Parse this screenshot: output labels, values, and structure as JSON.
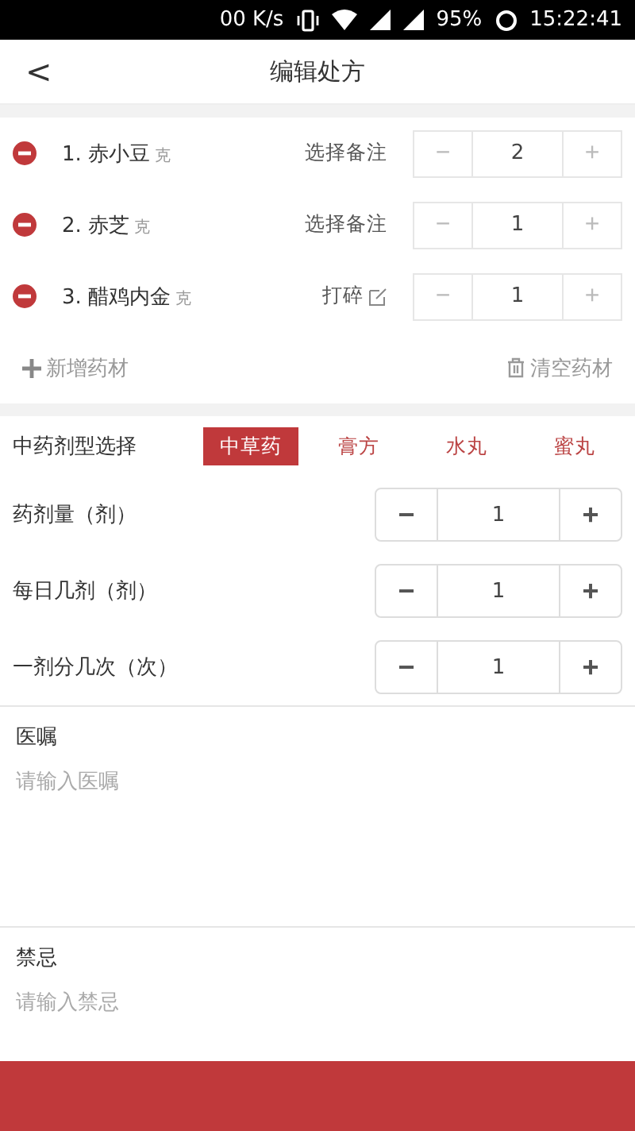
{
  "status_bar": {
    "speed": "00 K/s",
    "battery": "95%",
    "time": "15:22:41"
  },
  "header": {
    "back": "<",
    "title": "编辑处方"
  },
  "herbs": [
    {
      "index": "1.",
      "name": "赤小豆",
      "unit": "克",
      "note": "选择备注",
      "note_edit_icon": false,
      "minus": "−",
      "qty": "2",
      "plus": "+"
    },
    {
      "index": "2.",
      "name": "赤芝",
      "unit": "克",
      "note": "选择备注",
      "note_edit_icon": false,
      "minus": "−",
      "qty": "1",
      "plus": "+"
    },
    {
      "index": "3.",
      "name": "醋鸡内金",
      "unit": "克",
      "note": "打碎",
      "note_edit_icon": true,
      "minus": "−",
      "qty": "1",
      "plus": "+"
    }
  ],
  "add_button": "新增药材",
  "clear_button": "清空药材",
  "dosage_form": {
    "label": "中药剂型选择",
    "options": [
      {
        "label": "中草药",
        "selected": true
      },
      {
        "label": "膏方",
        "selected": false
      },
      {
        "label": "水丸",
        "selected": false
      },
      {
        "label": "蜜丸",
        "selected": false
      }
    ]
  },
  "counters": [
    {
      "label": "药剂量（剂）",
      "minus": "−",
      "value": "1",
      "plus": "+"
    },
    {
      "label": "每日几剂（剂）",
      "minus": "−",
      "value": "1",
      "plus": "+"
    },
    {
      "label": "一剂分几次（次）",
      "minus": "−",
      "value": "1",
      "plus": "+"
    }
  ],
  "notes": [
    {
      "label": "医嘱",
      "placeholder": "请输入医嘱"
    },
    {
      "label": "禁忌",
      "placeholder": "请输入禁忌"
    }
  ]
}
